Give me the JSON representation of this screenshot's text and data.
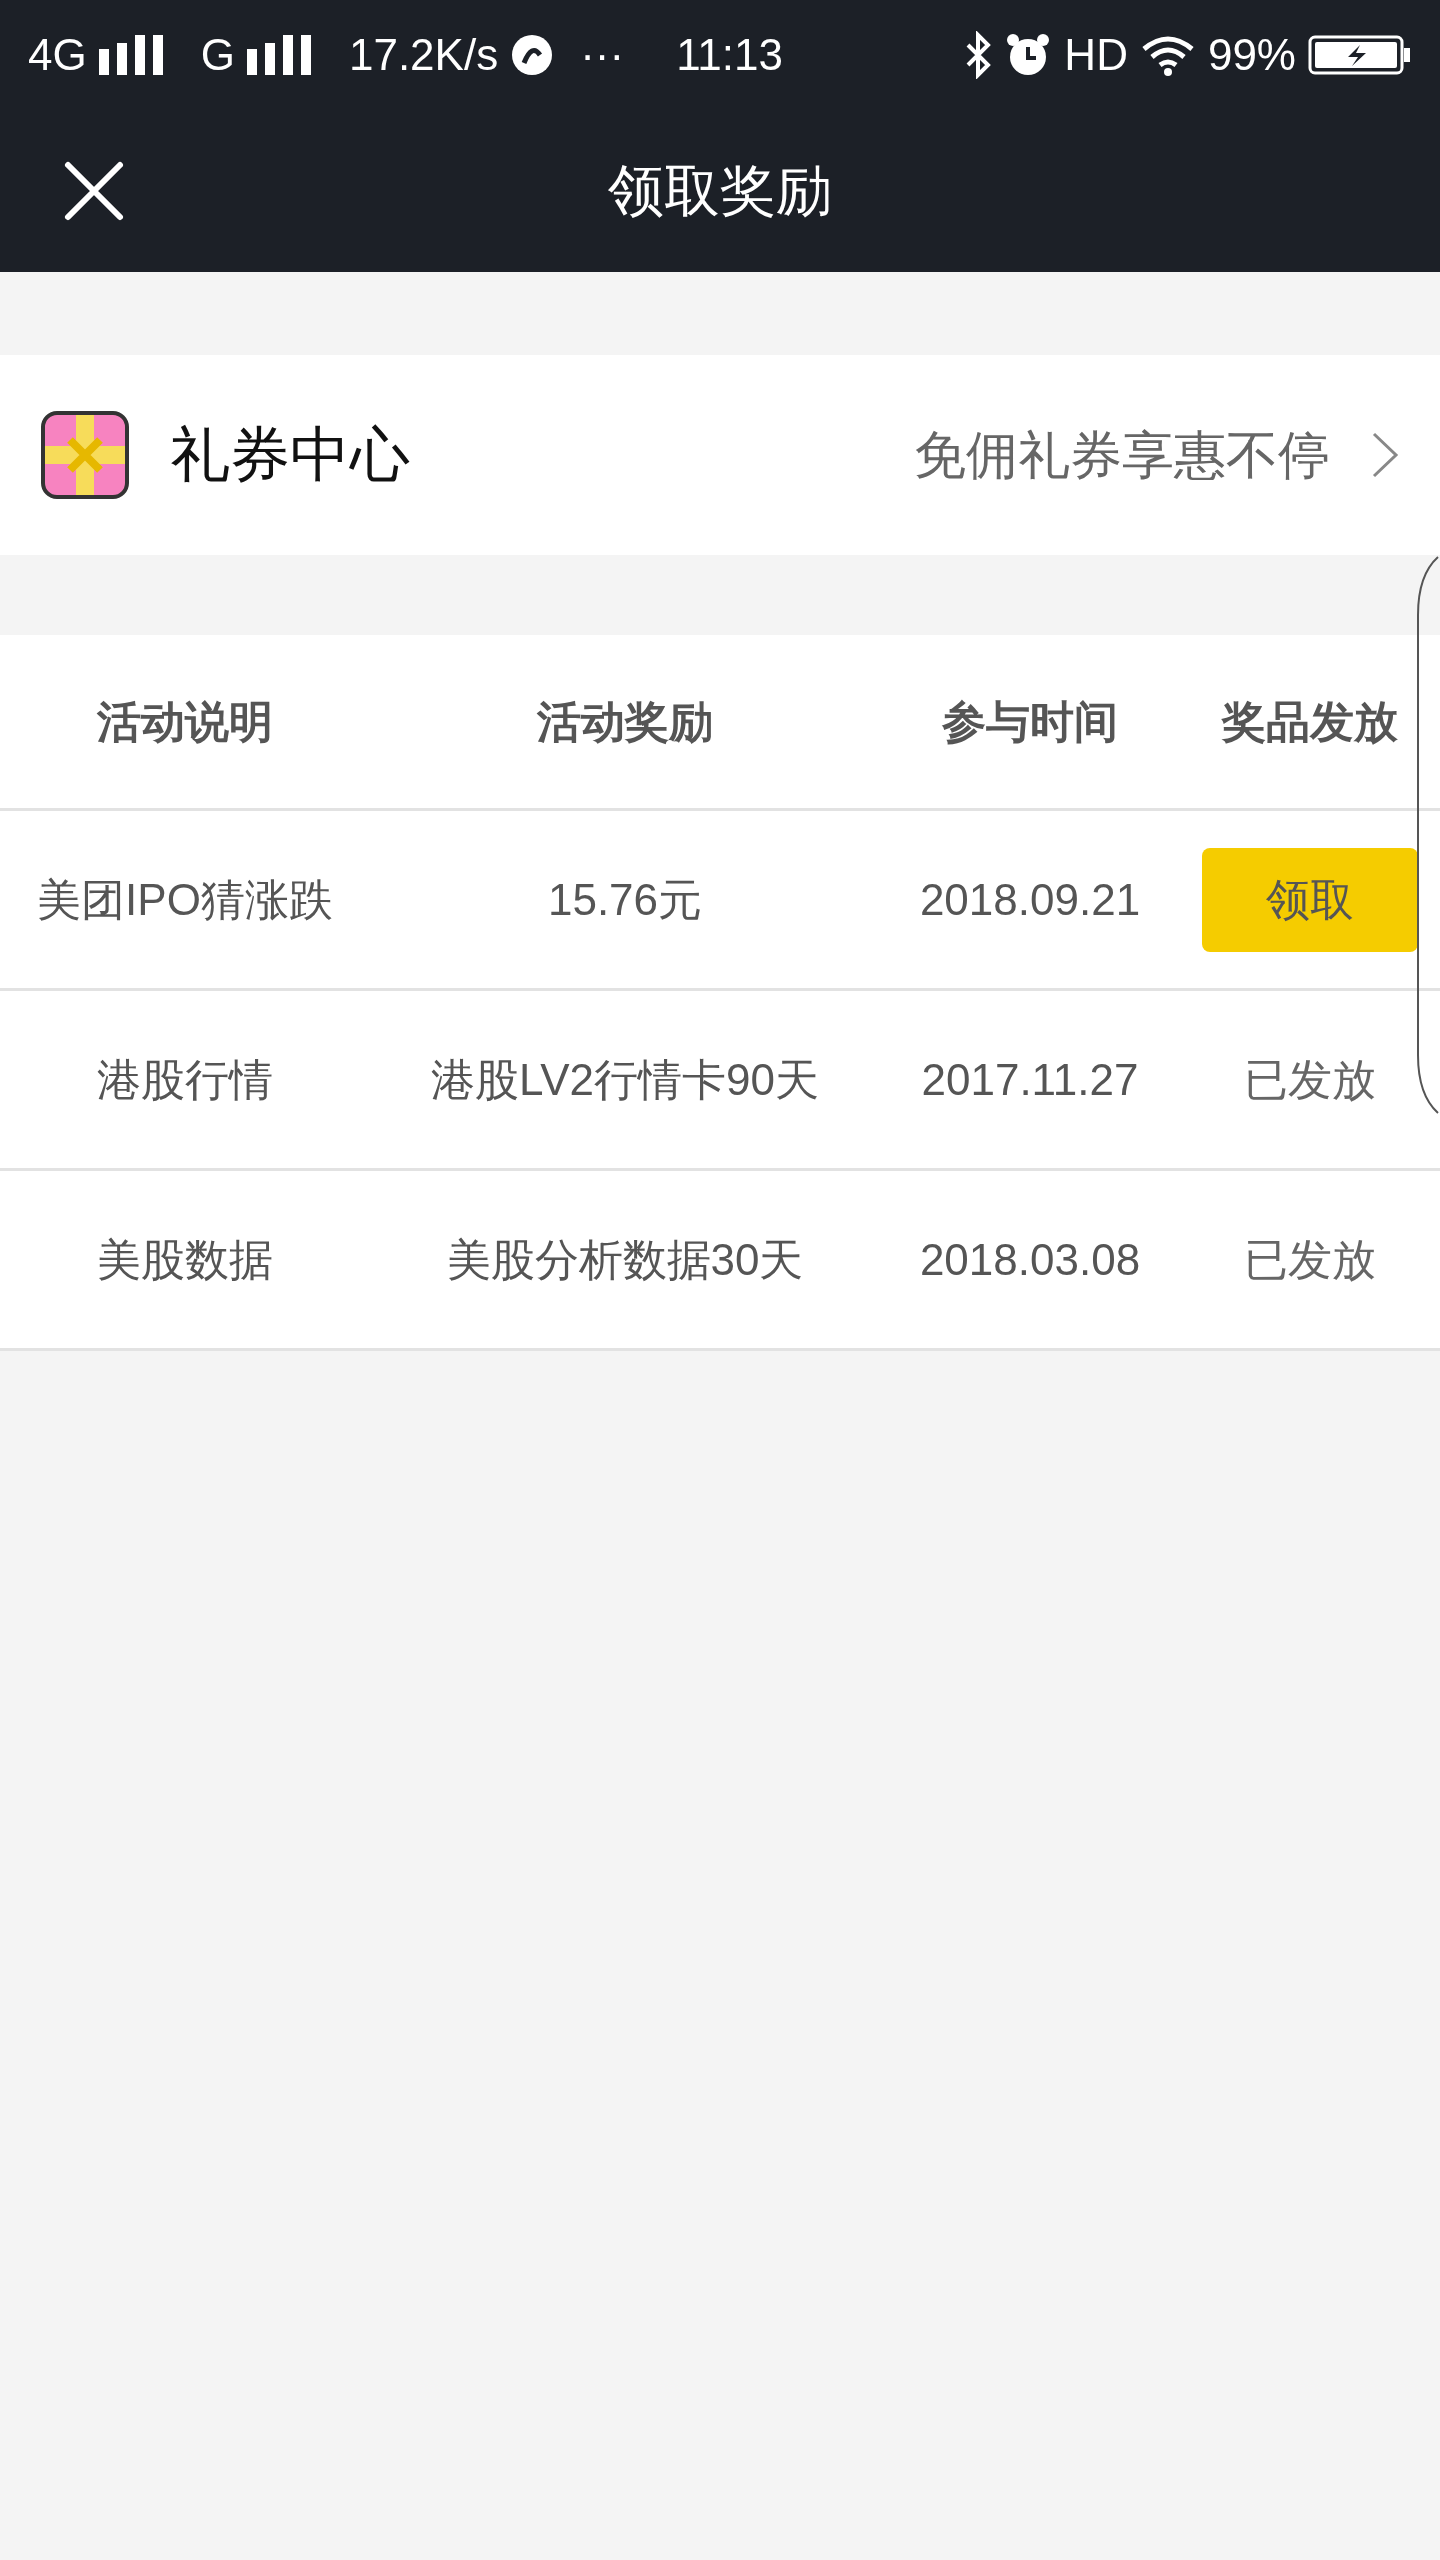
{
  "status_bar": {
    "network_1": "4G",
    "network_2": "G",
    "speed": "17.2K/s",
    "more": "···",
    "time": "11:13",
    "hd": "HD",
    "battery": "99%"
  },
  "header": {
    "title": "领取奖励"
  },
  "coupon_center": {
    "title": "礼券中心",
    "subtitle": "免佣礼券享惠不停"
  },
  "table": {
    "columns": [
      "活动说明",
      "活动奖励",
      "参与时间",
      "奖品发放"
    ],
    "rows": [
      {
        "activity": "美团IPO猜涨跌",
        "reward": "15.76元",
        "date": "2018.09.21",
        "delivery": {
          "kind": "button",
          "label": "领取"
        }
      },
      {
        "activity": "港股行情",
        "reward": "港股LV2行情卡90天",
        "date": "2017.11.27",
        "delivery": {
          "kind": "text",
          "label": "已发放"
        }
      },
      {
        "activity": "美股数据",
        "reward": "美股分析数据30天",
        "date": "2018.03.08",
        "delivery": {
          "kind": "text",
          "label": "已发放"
        }
      }
    ]
  }
}
